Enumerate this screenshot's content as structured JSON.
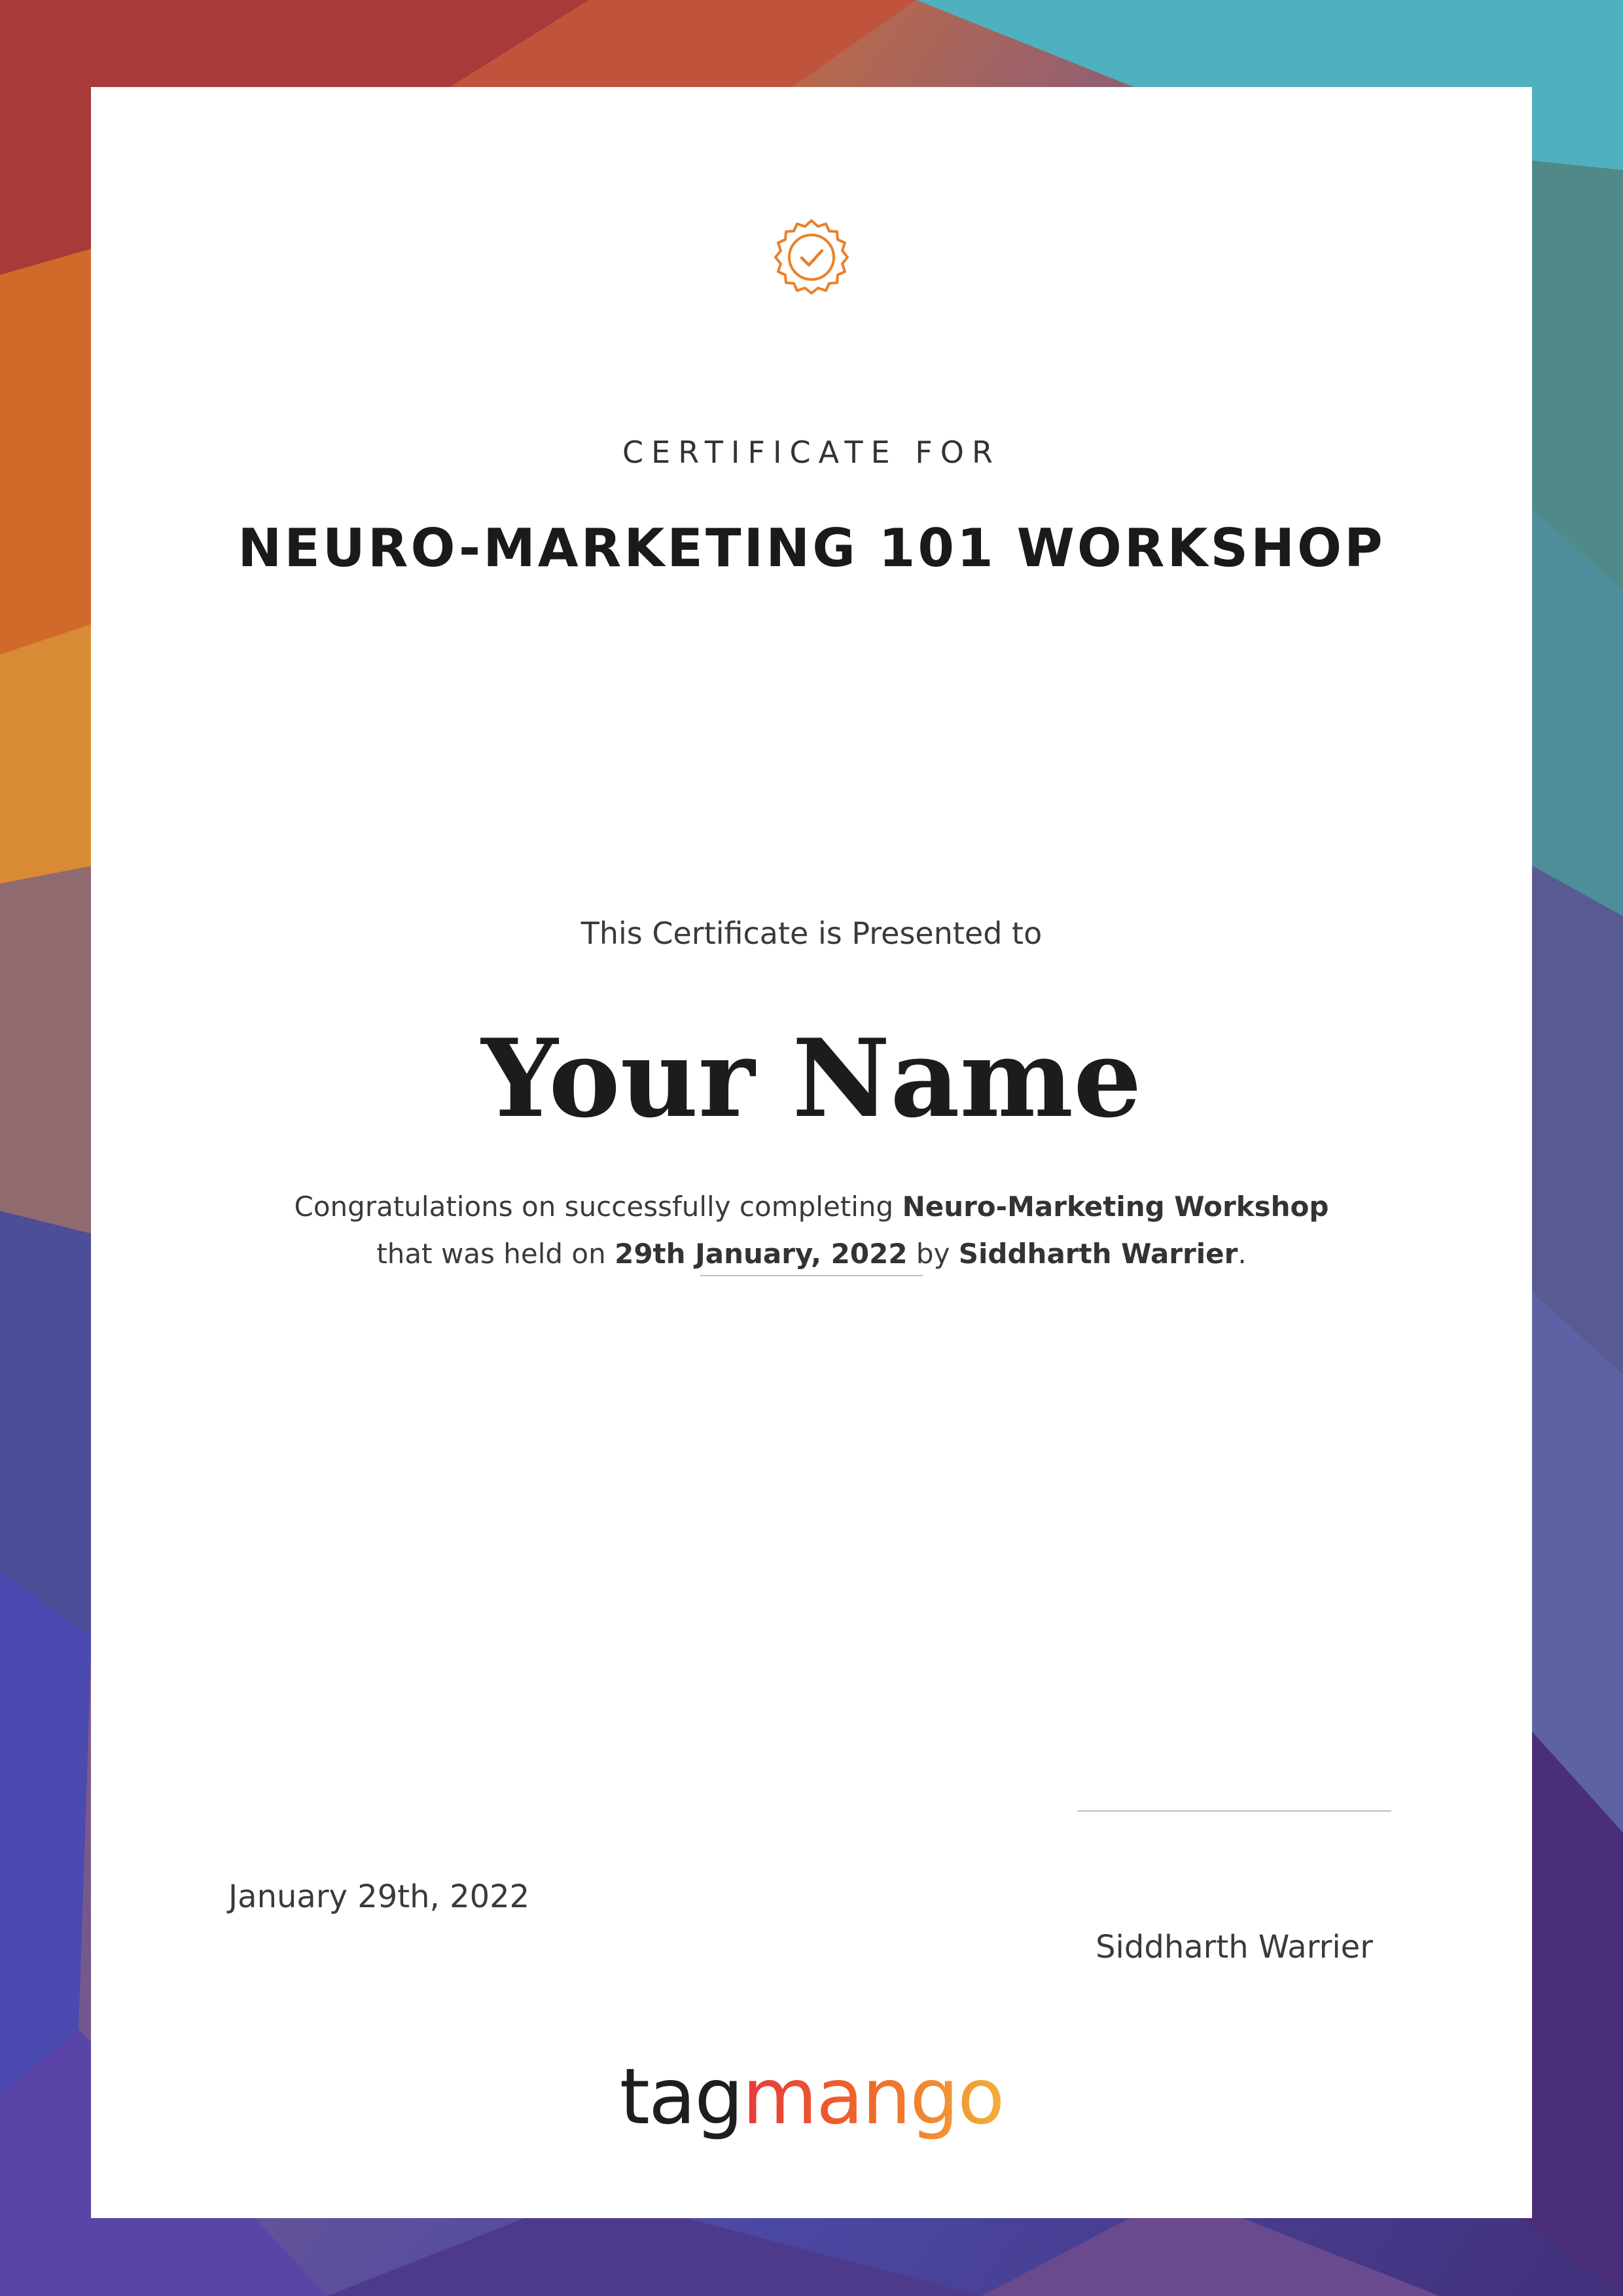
{
  "certificate": {
    "eyebrow": "CERTIFICATE FOR",
    "course_title": "NEURO-MARKETING 101 WORKSHOP",
    "presented_to": "This Certificate is Presented to",
    "recipient_name": "Your Name",
    "congrats": {
      "lead": "Congratulations on successfully completing ",
      "course": "Neuro-Marketing Workshop",
      "mid": "that was held on ",
      "date": "29th January, 2022",
      "by": " by ",
      "host": "Siddharth Warrier",
      "end": "."
    },
    "date_label": "January 29th, 2022",
    "signature_name": "Siddharth Warrier",
    "badge_icon": "verified-seal-icon"
  },
  "brand": {
    "logo_part1": "tag",
    "logo_part2": "mango",
    "accent": "#E8812A",
    "logo_gradient": [
      "#E63A3A",
      "#EF6A2A",
      "#F3B03A"
    ]
  }
}
